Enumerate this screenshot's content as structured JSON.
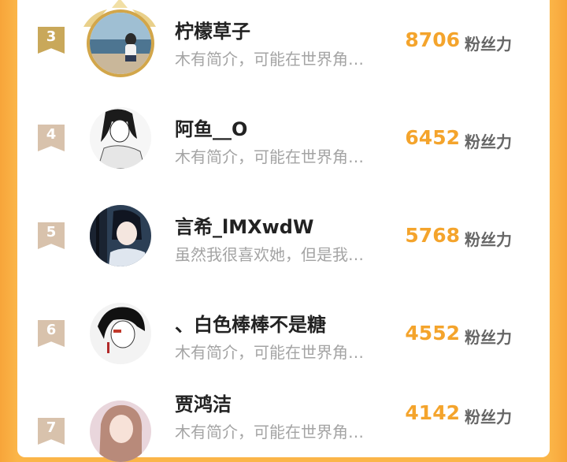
{
  "unit_label": "粉丝力",
  "rows": [
    {
      "rank": "3",
      "name": "柠檬草子",
      "bio": "木有简介，可能在世界角…",
      "fans": "8706"
    },
    {
      "rank": "4",
      "name": "阿鱼__O",
      "bio": "木有简介，可能在世界角…",
      "fans": "6452"
    },
    {
      "rank": "5",
      "name": "言希_lMXwdW",
      "bio": "虽然我很喜欢她，但是我…",
      "fans": "5768"
    },
    {
      "rank": "6",
      "name": "、白色棒棒不是糖",
      "bio": "木有简介，可能在世界角…",
      "fans": "4552"
    },
    {
      "rank": "7",
      "name": "贾鸿洁",
      "bio": "木有简介，可能在世界角…",
      "fans": "4142"
    }
  ],
  "colors": {
    "background": "#fbb548",
    "card": "#ffffff",
    "fans_count": "#f4a42c",
    "rank_gold": "#c9a85a",
    "rank_plain": "#d8c2ac",
    "bio_text": "#a4a4a4"
  }
}
